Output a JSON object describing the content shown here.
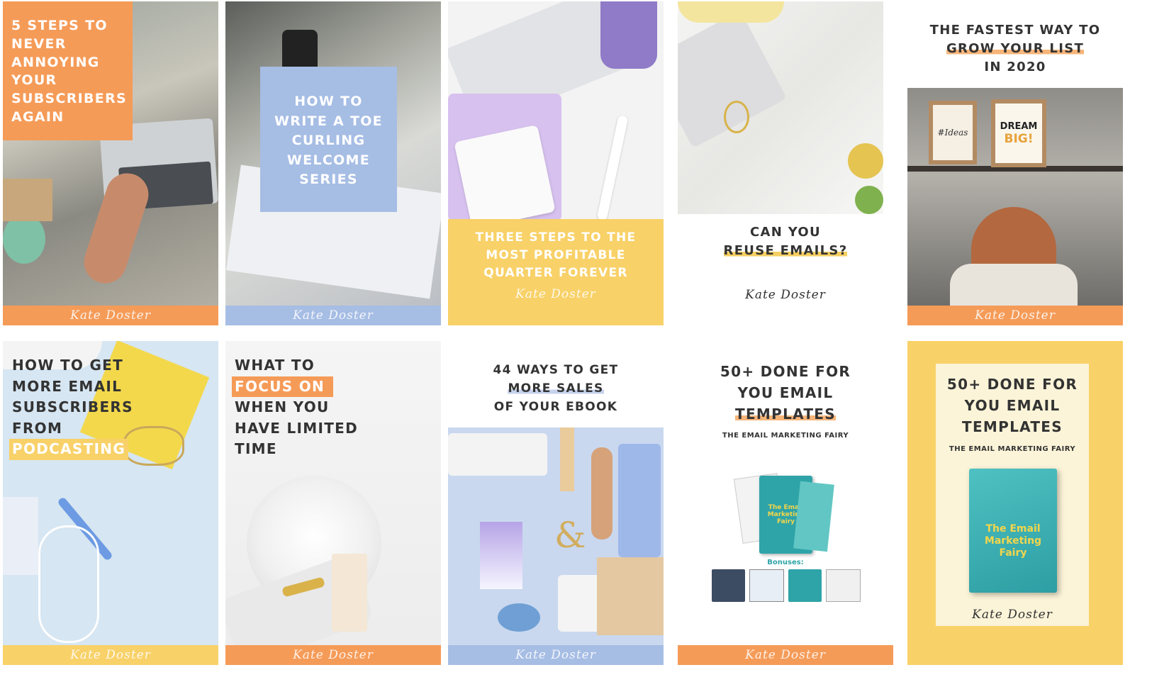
{
  "signature": "Kate Doster",
  "colors": {
    "orange": "#f59b58",
    "blue": "#a6bde4",
    "yellow": "#f8d168",
    "paleblue": "#dce8f3",
    "dark": "#3a3a3a"
  },
  "cards": [
    {
      "title_lines": [
        "5 STEPS TO",
        "NEVER",
        "ANNOYING",
        "YOUR",
        "SUBSCRIBERS",
        "AGAIN"
      ]
    },
    {
      "title_lines": [
        "HOW TO",
        "WRITE A TOE",
        "CURLING",
        "WELCOME",
        "SERIES"
      ]
    },
    {
      "title_lines": [
        "THREE STEPS TO THE",
        "MOST PROFITABLE",
        "QUARTER FOREVER"
      ]
    },
    {
      "title_lines": [
        "CAN YOU",
        "REUSE EMAILS?"
      ]
    },
    {
      "title_lines": [
        "THE FASTEST WAY TO",
        "GROW YOUR LIST",
        "IN 2020"
      ],
      "frame_left": "#Ideas",
      "frame_right_1": "DREAM",
      "frame_right_2": "BIG!"
    },
    {
      "title_lines": [
        "HOW TO GET",
        "MORE EMAIL",
        "SUBSCRIBERS",
        "FROM",
        "PODCASTING"
      ]
    },
    {
      "title_lines": [
        "WHAT TO",
        "FOCUS ON",
        "WHEN YOU",
        "HAVE LIMITED",
        "TIME"
      ]
    },
    {
      "title_lines": [
        "44 WAYS TO GET",
        "MORE SALES",
        "OF YOUR EBOOK"
      ]
    },
    {
      "title_lines": [
        "50+ DONE FOR",
        "YOU EMAIL",
        "TEMPLATES"
      ],
      "subtitle": "THE EMAIL MARKETING FAIRY",
      "book_title": "The Email Marketing Fairy",
      "bonuses": "Bonuses:"
    },
    {
      "title_lines": [
        "50+ DONE FOR",
        "YOU EMAIL",
        "TEMPLATES"
      ],
      "subtitle": "THE EMAIL MARKETING FAIRY",
      "book_title": "The Email Marketing Fairy"
    }
  ]
}
